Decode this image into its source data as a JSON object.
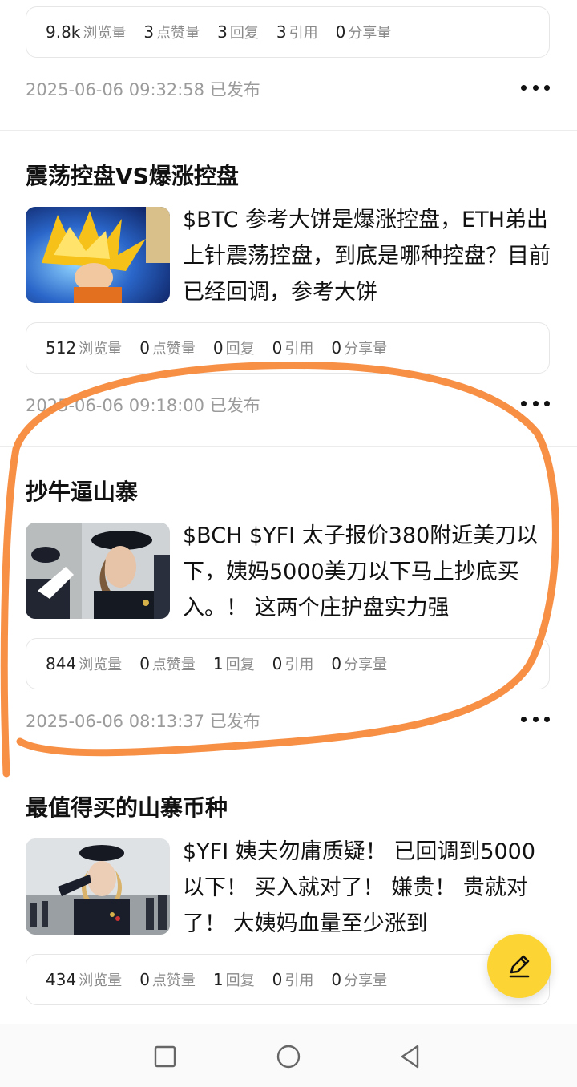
{
  "posts": [
    {
      "stats": [
        {
          "num": "9.8k",
          "label": "浏览量"
        },
        {
          "num": "3",
          "label": "点赞量"
        },
        {
          "num": "3",
          "label": "回复"
        },
        {
          "num": "3",
          "label": "引用"
        },
        {
          "num": "0",
          "label": "分享量"
        }
      ],
      "time": "2025-06-06 09:32:58 已发布"
    },
    {
      "title": "震荡控盘VS爆涨控盘",
      "excerpt": "$BTC 参考大饼是爆涨控盘，ETH弟出上针震荡控盘，到底是哪种控盘？目前已经回调，参考大饼",
      "stats": [
        {
          "num": "512",
          "label": "浏览量"
        },
        {
          "num": "0",
          "label": "点赞量"
        },
        {
          "num": "0",
          "label": "回复"
        },
        {
          "num": "0",
          "label": "引用"
        },
        {
          "num": "0",
          "label": "分享量"
        }
      ],
      "time": "2025-06-06 09:18:00 已发布"
    },
    {
      "title": "抄牛逼山寨",
      "excerpt": "$BCH $YFI 太子报价380附近美刀以下，姨妈5000美刀以下马上抄底买入。！ 这两个庄护盘实力强",
      "stats": [
        {
          "num": "844",
          "label": "浏览量"
        },
        {
          "num": "0",
          "label": "点赞量"
        },
        {
          "num": "1",
          "label": "回复"
        },
        {
          "num": "0",
          "label": "引用"
        },
        {
          "num": "0",
          "label": "分享量"
        }
      ],
      "time": "2025-06-06 08:13:37 已发布"
    },
    {
      "title": "最值得买的山寨币种",
      "excerpt": "$YFI 姨夫勿庸质疑！ 已回调到5000以下！ 买入就对了！ 嫌贵！ 贵就对了！ 大姨妈血量至少涨到",
      "stats": [
        {
          "num": "434",
          "label": "浏览量"
        },
        {
          "num": "0",
          "label": "点赞量"
        },
        {
          "num": "1",
          "label": "回复"
        },
        {
          "num": "0",
          "label": "引用"
        },
        {
          "num": "0",
          "label": "分享量"
        }
      ]
    }
  ],
  "icons": {
    "fab": "pencil-icon",
    "nav_recent": "square-icon",
    "nav_home": "circle-icon",
    "nav_back": "triangle-back-icon",
    "more": "more-dots-icon"
  },
  "colors": {
    "accent": "#fcd535",
    "annotation": "#f7893b"
  }
}
